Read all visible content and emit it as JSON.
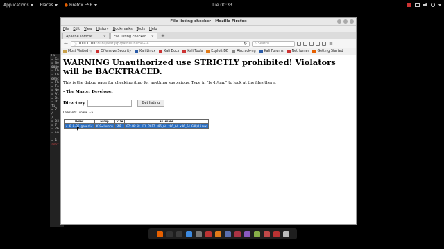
{
  "topbar": {
    "applications": "Applications",
    "places": "Places",
    "app": "Firefox ESR",
    "clock": "Tue 00:33"
  },
  "terminal": {
    "lines": [
      "Fi",
      "= Se",
      "= Se",
      "004e",
      "= Th",
      "= Th",
      "genc",
      "= Th",
      "= To",
      "= Ne",
      "= Al",
      "= Di",
      "= Di",
      "  fi",
      "= 7",
      "/",
      "/",
      "= DS",
      "= 7",
      "= 76",
      "= En",
      "",
      "= 1",
      "root"
    ]
  },
  "firefox": {
    "window_title": "File listing checker - Mozilla Firefox",
    "menu": [
      "File",
      "Edit",
      "View",
      "History",
      "Bookmarks",
      "Tools",
      "Help"
    ],
    "tabs": [
      "Apache Tomcat",
      "File listing checker"
    ],
    "url_host": "10.0.1.100",
    "url_path": ":8080/test.jsp?path=uname+-a",
    "search_placeholder": "Search",
    "bookmarks": [
      "Most Visited",
      "Offensive Security",
      "Kali Linux",
      "Kali Docs",
      "Kali Tools",
      "Exploit-DB",
      "Aircrack-ng",
      "Kali Forums",
      "NetHunter",
      "Getting Started"
    ]
  },
  "page": {
    "warning": "WARNING Unauthorized use STRICTLY prohibited! Violators will be BACKTRACED.",
    "intro": "This is the debug page for checking /tmp for anything suspicious. Type in \"ls -l /tmp\" to look at the files there.",
    "signature": "- The Master Developer",
    "directory_label": "Directory",
    "directory_value": "",
    "button_label": "Get listing",
    "command_line": "Command: uname -a",
    "table": {
      "headers": [
        "Owner",
        "Group",
        "Size",
        "Filename"
      ],
      "row": [
        "4.6.0-35-generic",
        "#39~Ubuntu",
        "SMP",
        "07:46:58 UTC 2017 x86_64 x86_64 x86_64 GNU/Linux"
      ]
    }
  },
  "dock_icons": [
    "firefox-icon",
    "kali-icon",
    "terminal-icon",
    "files-icon",
    "metasploit-icon",
    "armitage-icon",
    "burp-icon",
    "maltego-icon",
    "beef-icon",
    "faraday-icon",
    "leafpad-icon",
    "cherrytree-icon",
    "recordmydesktop-icon",
    "app-grid-icon"
  ],
  "dock_colors": [
    "#e66000",
    "#333",
    "#3a3a3a",
    "#3d8ae0",
    "#777",
    "#bb3333",
    "#e07b1a",
    "#5a6fb0",
    "#aa3344",
    "#8a5ac0",
    "#88b048",
    "#c04848",
    "#b83232",
    "#bbbbbb"
  ]
}
